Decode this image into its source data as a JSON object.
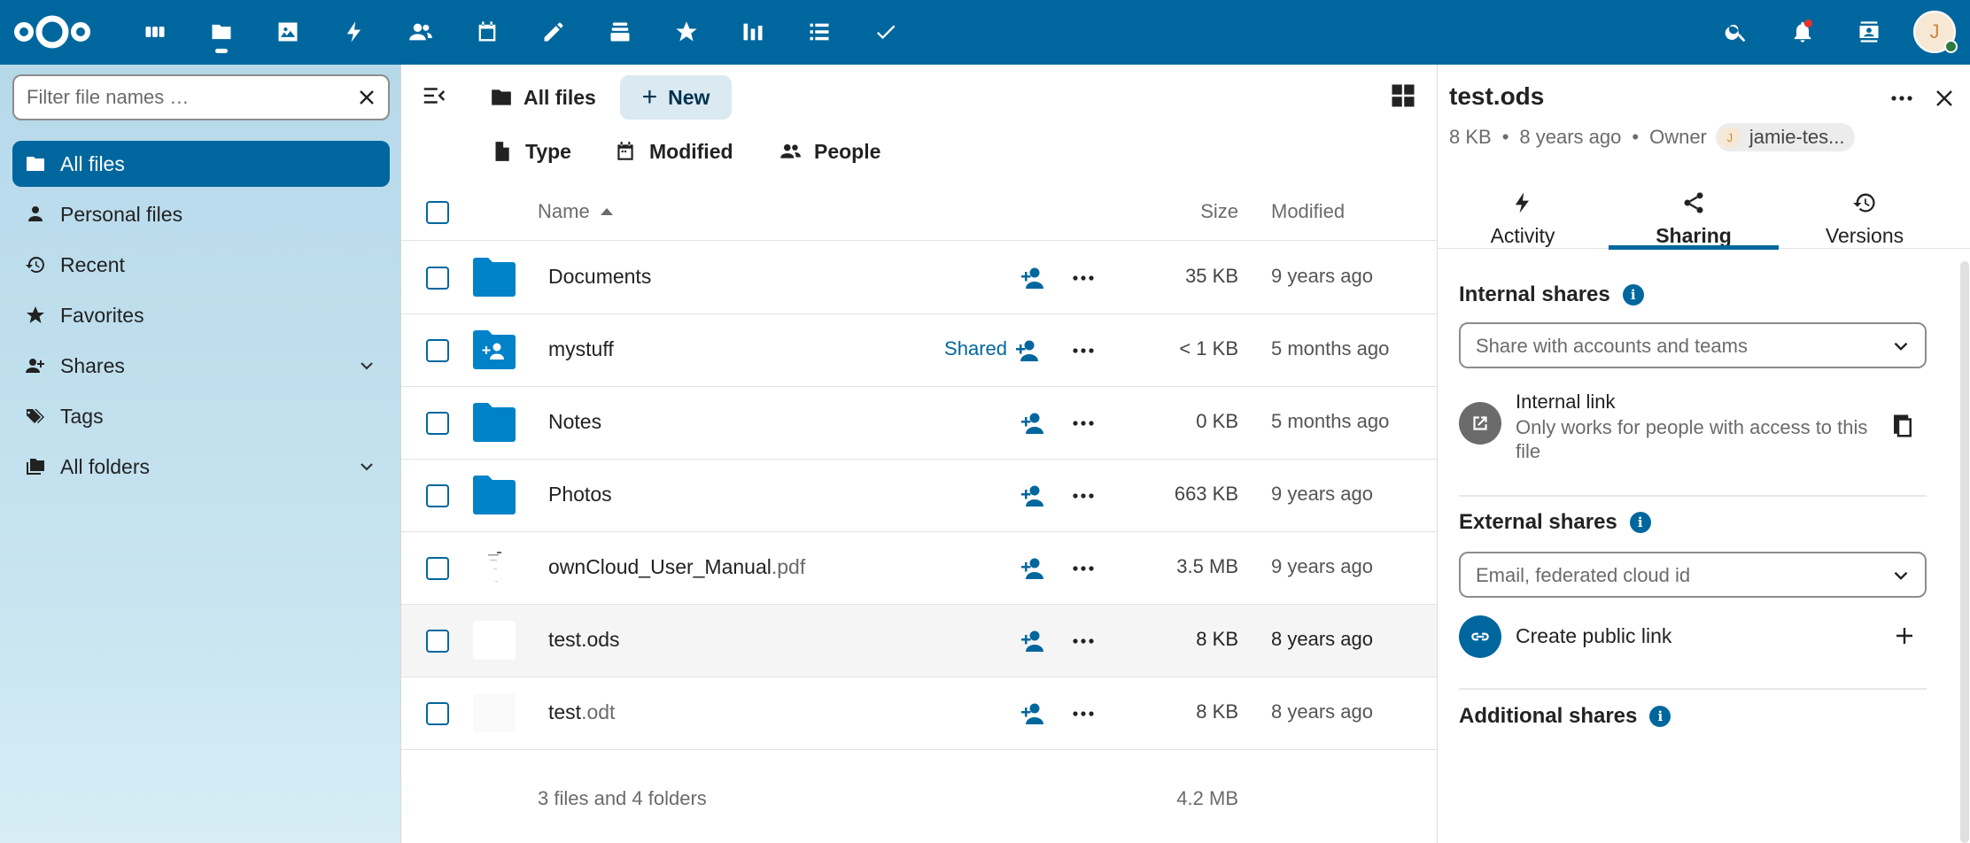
{
  "header": {
    "apps": [
      "Dashboard",
      "Files",
      "Photos",
      "Activity",
      "Contacts",
      "Calendar",
      "Notes",
      "Deck",
      "Favorites",
      "Analytics",
      "Tasks",
      "Check"
    ],
    "right_icons": [
      "search-icon",
      "notifications-icon",
      "contacts-menu-icon"
    ],
    "avatar_initial": "J",
    "brand_color": "#00679e"
  },
  "nav": {
    "filter_placeholder": "Filter file names …",
    "items": [
      {
        "label": "All files",
        "icon": "folder-icon",
        "active": true
      },
      {
        "label": "Personal files",
        "icon": "person-icon"
      },
      {
        "label": "Recent",
        "icon": "history-icon"
      },
      {
        "label": "Favorites",
        "icon": "star-icon"
      },
      {
        "label": "Shares",
        "icon": "share-icon",
        "expandable": true
      },
      {
        "label": "Tags",
        "icon": "tag-icon"
      },
      {
        "label": "All folders",
        "icon": "folders-icon",
        "expandable": true
      }
    ]
  },
  "toolbar": {
    "breadcrumb": "All files",
    "new_label": "New",
    "filters": [
      "Type",
      "Modified",
      "People"
    ]
  },
  "list": {
    "columns": {
      "name": "Name",
      "size": "Size",
      "modified": "Modified"
    },
    "rows": [
      {
        "name": "Documents",
        "ext": "",
        "type": "folder",
        "size": "35 KB",
        "modified": "9 years ago"
      },
      {
        "name": "mystuff",
        "ext": "",
        "type": "shared-folder",
        "shared": "Shared",
        "size": "< 1 KB",
        "modified": "5 months ago"
      },
      {
        "name": "Notes",
        "ext": "",
        "type": "folder",
        "size": "0 KB",
        "modified": "5 months ago"
      },
      {
        "name": "Photos",
        "ext": "",
        "type": "folder",
        "size": "663 KB",
        "modified": "9 years ago"
      },
      {
        "name": "ownCloud_User_Manual",
        "ext": ".pdf",
        "type": "pdf",
        "size": "3.5 MB",
        "modified": "9 years ago"
      },
      {
        "name": "test.ods",
        "ext": "",
        "type": "file",
        "size": "8 KB",
        "modified": "8 years ago",
        "selected": true
      },
      {
        "name": "test",
        "ext": ".odt",
        "type": "file",
        "size": "8 KB",
        "modified": "8 years ago"
      }
    ],
    "summary": "3 files and 4 folders",
    "summary_size": "4.2 MB"
  },
  "sidebar": {
    "title": "test.ods",
    "size": "8 KB",
    "sep": "•",
    "modified": "8 years ago",
    "owner_label": "Owner",
    "owner_name": "jamie-tes...",
    "owner_initial": "J",
    "tabs": [
      {
        "label": "Activity",
        "icon": "activity-icon"
      },
      {
        "label": "Sharing",
        "icon": "share-icon",
        "active": true
      },
      {
        "label": "Versions",
        "icon": "history-icon"
      }
    ],
    "internal_title": "Internal shares",
    "internal_placeholder": "Share with accounts and teams",
    "internal_link_title": "Internal link",
    "internal_link_desc": "Only works for people with access to this file",
    "external_title": "External shares",
    "external_placeholder": "Email, federated cloud id",
    "public_link_label": "Create public link",
    "additional_title": "Additional shares",
    "info_glyph": "i"
  }
}
